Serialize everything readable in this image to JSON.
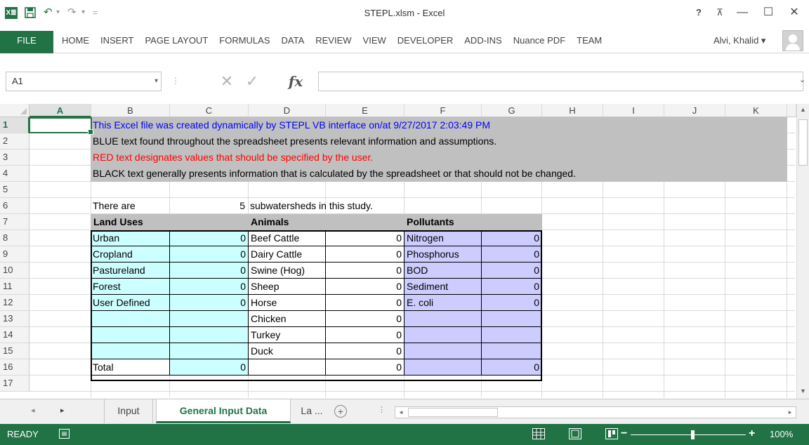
{
  "window": {
    "title": "STEPL.xlsm - Excel",
    "logo_text": "X≣",
    "help": "?",
    "ribbon_display": "⊼",
    "minimize": "—",
    "maximize": "☐",
    "close": "✕"
  },
  "qat": {
    "save_icon": "floppy-icon",
    "undo": "↶",
    "undo_dd": "▾",
    "redo": "↷",
    "redo_dd": "▾",
    "customize": "="
  },
  "ribbon": {
    "file_label": "FILE",
    "tabs": [
      "HOME",
      "INSERT",
      "PAGE LAYOUT",
      "FORMULAS",
      "DATA",
      "REVIEW",
      "VIEW",
      "DEVELOPER",
      "ADD-INS",
      "Nuance PDF",
      "TEAM"
    ],
    "user": "Alvi, Khalid ▾"
  },
  "formula_bar": {
    "name_box": "A1",
    "dropdown": "▾",
    "separator": "⋮",
    "cancel": "✕",
    "enter": "✓",
    "fx": "fx",
    "formula": "",
    "expand": "⌄"
  },
  "grid": {
    "columns": [
      "A",
      "B",
      "C",
      "D",
      "E",
      "F",
      "G",
      "H",
      "I",
      "J",
      "K"
    ],
    "rows": [
      "1",
      "2",
      "3",
      "4",
      "5",
      "6",
      "7",
      "8",
      "9",
      "10",
      "11",
      "12",
      "13",
      "14",
      "15",
      "16",
      "17"
    ],
    "info": {
      "line1": "This Excel file was created dynamically by STEPL VB interface on/at 9/27/2017 2:03:49 PM",
      "line2": "BLUE text found throughout the spreadsheet presents relevant information and assumptions.",
      "line3": "RED text designates values that should be specified by the user.",
      "line4": "BLACK text generally presents information that is calculated by the spreadsheet or that should not be changed."
    },
    "summary": {
      "prefix": "There are",
      "count": "5",
      "suffix": "subwatersheds in this study."
    },
    "headers": {
      "land_uses": "Land Uses",
      "animals": "Animals",
      "pollutants": "Pollutants"
    },
    "land_uses": [
      {
        "name": "Urban",
        "value": "0"
      },
      {
        "name": "Cropland",
        "value": "0"
      },
      {
        "name": "Pastureland",
        "value": "0"
      },
      {
        "name": "Forest",
        "value": "0"
      },
      {
        "name": "User Defined",
        "value": "0"
      }
    ],
    "animals": [
      {
        "name": "Beef Cattle",
        "value": "0"
      },
      {
        "name": "Dairy Cattle",
        "value": "0"
      },
      {
        "name": "Swine (Hog)",
        "value": "0"
      },
      {
        "name": "Sheep",
        "value": "0"
      },
      {
        "name": "Horse",
        "value": "0"
      },
      {
        "name": "Chicken",
        "value": "0"
      },
      {
        "name": "Turkey",
        "value": "0"
      },
      {
        "name": "Duck",
        "value": "0"
      }
    ],
    "pollutants": [
      {
        "name": "Nitrogen",
        "value": "0"
      },
      {
        "name": "Phosphorus",
        "value": "0"
      },
      {
        "name": "BOD",
        "value": "0"
      },
      {
        "name": "Sediment",
        "value": "0"
      },
      {
        "name": "E. coli",
        "value": "0"
      }
    ],
    "totals": {
      "label": "Total",
      "land": "0",
      "animals": "0",
      "pollutants": "0"
    }
  },
  "sheets": {
    "tabs": [
      "Input",
      "General Input Data",
      "La ..."
    ],
    "active": "General Input Data",
    "add": "+",
    "nav_prev": "◂",
    "nav_next": "▸",
    "more": "⋮"
  },
  "status": {
    "ready": "READY",
    "macro_icon": "macro-record-icon",
    "zoom_minus": "−",
    "zoom_plus": "+",
    "zoom": "100%"
  },
  "colors": {
    "excel_green": "#217346",
    "info_band": "#c0c0c0",
    "cyan": "#ccffff",
    "lavender": "#ccccff",
    "blue_text": "#0000ff",
    "red_text": "#ff0000"
  }
}
